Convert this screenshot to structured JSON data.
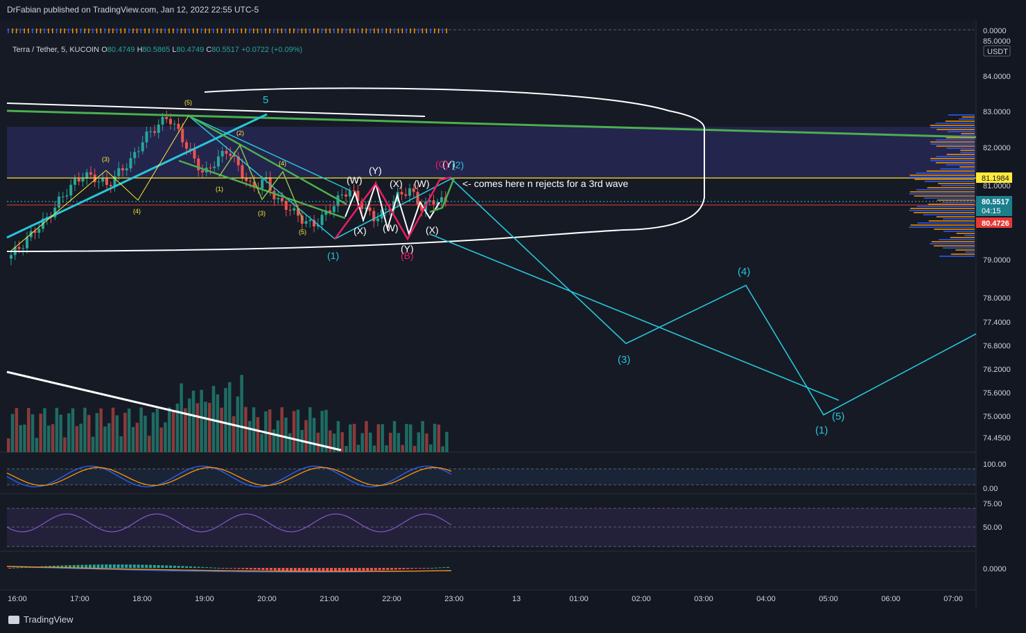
{
  "header": {
    "publisher": "DrFabian published on TradingView.com, Jan 12, 2022 22:55 UTC-5"
  },
  "legend": {
    "symbol": "Terra / Tether, 5, KUCOIN",
    "o_label": "O",
    "o": "80.4749",
    "h_label": "H",
    "h": "80.5865",
    "l_label": "L",
    "l": "80.4749",
    "c_label": "C",
    "c": "80.5517",
    "change": "+0.0722 (+0.09%)"
  },
  "price_axis": {
    "currency": "USDT",
    "top_zero": "0.0000",
    "tick_partial": "85.0000",
    "ticks": [
      "84.0000",
      "83.0000",
      "82.0000",
      "81.0000",
      "79.0000",
      "78.0000",
      "77.4000",
      "76.8000",
      "76.2000",
      "75.6000",
      "75.0000",
      "74.4500"
    ],
    "label_yellow": "81.1984",
    "label_teal": "80.5517",
    "label_timer": "04:15",
    "label_red": "80.4726",
    "stoch_ticks": [
      "100.00",
      "0.00"
    ],
    "rsi_ticks": [
      "75.00",
      "50.00"
    ],
    "macd_tick": "0.0000"
  },
  "time_axis": [
    "16:00",
    "17:00",
    "18:00",
    "19:00",
    "20:00",
    "21:00",
    "22:00",
    "23:00",
    "13",
    "01:00",
    "02:00",
    "03:00",
    "04:00",
    "05:00",
    "06:00",
    "07:00"
  ],
  "annotations": {
    "note": "<- comes here n rejects for a 3rd wave",
    "big5": "5",
    "w1": "(1)",
    "w3": "(3)",
    "w4": "(4)",
    "w5": "(5)",
    "w1b": "(1)",
    "small": [
      "(5)",
      "(3)",
      "(4)",
      "(1)",
      "(2)",
      "(3)",
      "(4)",
      "(5)",
      "(3)"
    ],
    "wxy": [
      "(W)",
      "(X)",
      "(Y)",
      "(X)",
      "(W)",
      "(W)",
      "(X)",
      "(Y)",
      "(Y)",
      "(X)"
    ],
    "pink": [
      "(Y)",
      "(B)",
      "(C)"
    ],
    "teal_small": [
      "(1)",
      "(2)"
    ]
  },
  "footer": {
    "brand": "TradingView"
  },
  "colors": {
    "bg": "#161a25",
    "up": "#26a69a",
    "down": "#ef5350",
    "cyan": "#26c6da",
    "green": "#4caf50",
    "yellow": "#ffeb3b",
    "pink": "#e91e63",
    "zone": "#2a2a5a"
  },
  "chart_data": {
    "type": "line",
    "title": "Terra / Tether, 5, KUCOIN",
    "y_range": [
      74.45,
      85.0
    ],
    "candles_close_approx": [
      79.1,
      79.4,
      79.8,
      80.1,
      80.6,
      81.0,
      81.3,
      81.2,
      81.0,
      81.4,
      81.7,
      82.3,
      82.6,
      82.9,
      82.4,
      81.8,
      81.3,
      81.7,
      82.0,
      81.4,
      80.9,
      81.2,
      80.6,
      80.4,
      80.1,
      79.9,
      80.2,
      80.6,
      80.9,
      80.5,
      80.1,
      80.3,
      80.7,
      80.9,
      80.4,
      80.6,
      80.55
    ],
    "projection": {
      "labels": [
        "(1)",
        "(2)",
        "(3)",
        "(4)",
        "(5)"
      ],
      "values": [
        79.55,
        81.2,
        76.85,
        78.35,
        75.05
      ]
    },
    "levels": {
      "yellow_line": 81.1984,
      "teal_dotted": 80.5517,
      "red_line": 80.4726
    }
  }
}
